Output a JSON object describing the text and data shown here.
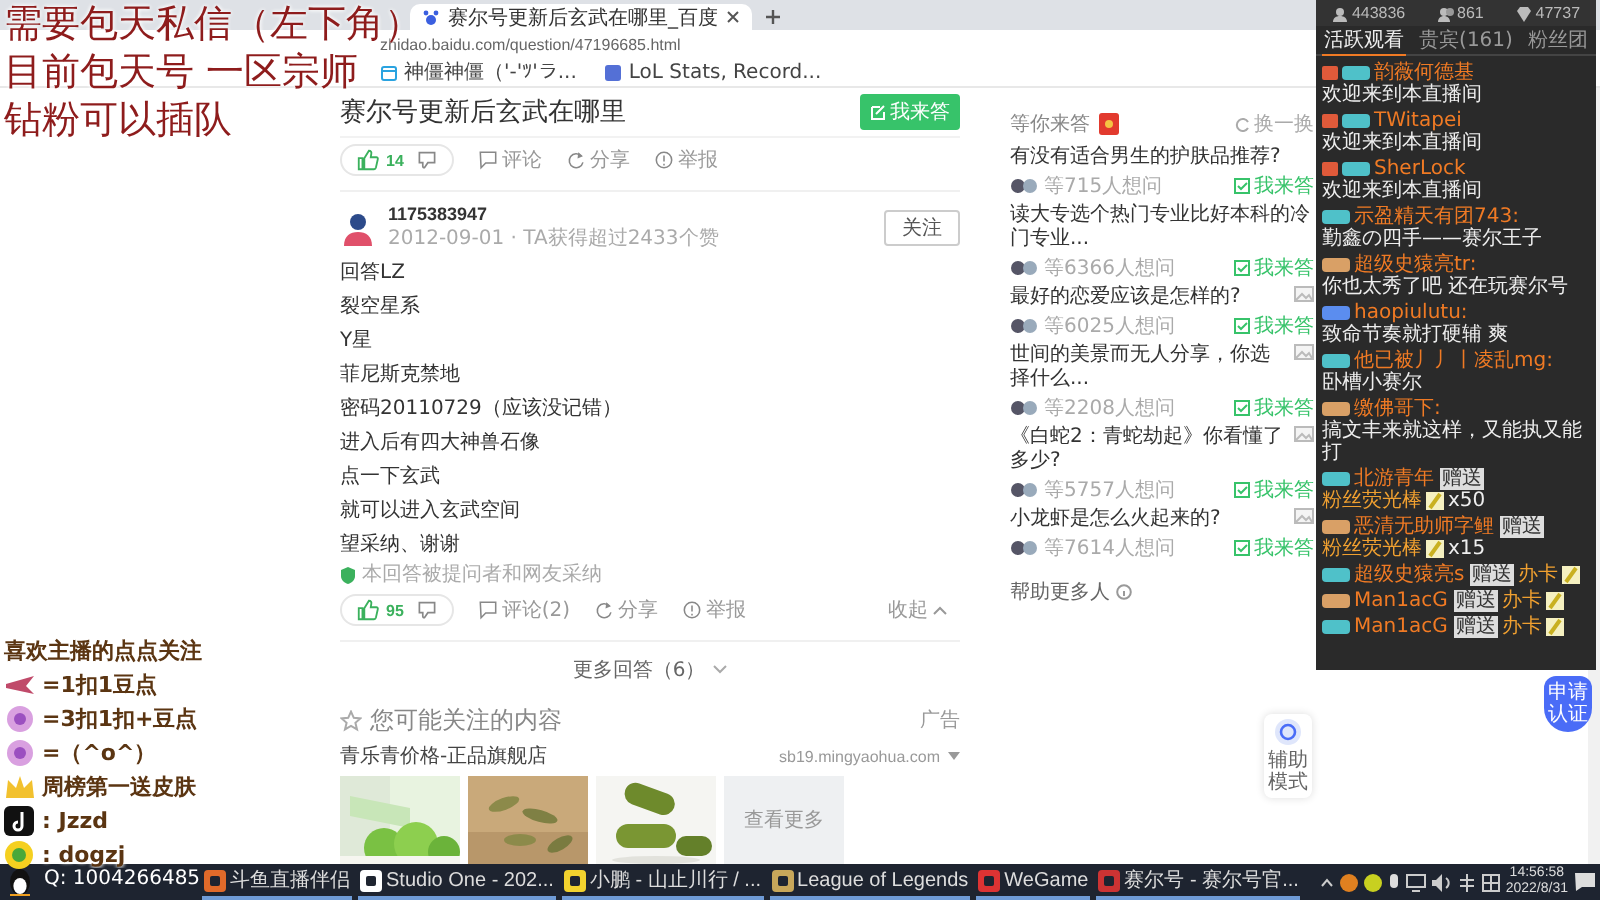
{
  "overlay_notice": [
    "需要包天私信（左下角）",
    "目前包天号 一区宗师",
    "钻粉可以插队"
  ],
  "browser": {
    "tab_title": "赛尔号更新后玄武在哪里_百度",
    "address": "zhidao.baidu.com/question/47196685.html",
    "bookmarks": [
      "神僵神僵（'-'ﾂ'ラ...",
      "LoL Stats, Record..."
    ]
  },
  "question": {
    "title": "赛尔号更新后玄武在哪里",
    "answer_button": "我来答"
  },
  "previous_answer": {
    "votes": "14",
    "actions": [
      "评论",
      "分享",
      "举报"
    ]
  },
  "answer": {
    "user": "1175383947",
    "meta": "2012-09-01 · TA获得超过2433个赞",
    "follow": "关注",
    "lines": [
      "回答LZ",
      "裂空星系",
      "Y星",
      "菲尼斯克禁地",
      "密码20110729（应该没记错）",
      "进入后有四大神兽石像",
      "点一下玄武",
      "就可以进入玄武空间",
      "望采纳、谢谢"
    ],
    "adopted": "本回答被提问者和网友采纳",
    "votes": "95",
    "actions": [
      "评论(2)",
      "分享",
      "举报"
    ],
    "collapse": "收起"
  },
  "more_answers": "更多回答（6）",
  "recommend": {
    "title": "您可能关注的内容",
    "ad_label": "广告",
    "shop": "青乐青价格-正品旗舰店",
    "domain": "sb19.mingyaohua.com",
    "more": "查看更多"
  },
  "sidebar": {
    "title": "等你来答",
    "refresh": "换一换",
    "questions": [
      {
        "text": "有没有适合男生的护肤品推荐?",
        "asked": "等715人想问",
        "button": "我来答",
        "thumbnail": false
      },
      {
        "text": "读大专选个热门专业比好本科的冷门专业...",
        "asked": "等6366人想问",
        "button": "我来答",
        "thumbnail": false
      },
      {
        "text": "最好的恋爱应该是怎样的?",
        "asked": "等6025人想问",
        "button": "我来答",
        "thumbnail": true
      },
      {
        "text": "世间的美景而无人分享，你选择什么...",
        "asked": "等2208人想问",
        "button": "我来答",
        "thumbnail": true
      },
      {
        "text": "《白蛇2：青蛇劫起》你看懂了多少?",
        "asked": "等5757人想问",
        "button": "我来答",
        "thumbnail": true
      },
      {
        "text": "小龙虾是怎么火起来的?",
        "asked": "等7614人想问",
        "button": "我来答",
        "thumbnail": true
      }
    ],
    "help": "帮助更多人"
  },
  "floating": {
    "assist": "辅助模式",
    "certify": "申请认证"
  },
  "chat": {
    "stats": [
      "443836",
      "861",
      "47737"
    ],
    "tabs": [
      {
        "label": "活跃观看",
        "selected": true
      },
      {
        "label": "贵宾(161)",
        "selected": false
      },
      {
        "label": "粉丝团",
        "selected": false
      }
    ],
    "messages": [
      {
        "kind": "welcome",
        "user": "韵薇何德基",
        "text": "欢迎来到本直播间"
      },
      {
        "kind": "welcome",
        "user": "TWitapei",
        "text": "欢迎来到本直播间"
      },
      {
        "kind": "welcome",
        "user": "SherLock",
        "text": "欢迎来到本直播间"
      },
      {
        "kind": "chat",
        "user": "示盈精天有团743:",
        "text": "勤鑫の四手——赛尔王子"
      },
      {
        "kind": "chat",
        "user": "超级史猿亮tr:",
        "text": "你也太秀了吧 还在玩赛尔号"
      },
      {
        "kind": "chat",
        "user": "haopiulutu:",
        "text": "致命节奏就打硬辅 爽"
      },
      {
        "kind": "chat",
        "user": "他已被丿丿丨凌乱mg:",
        "text": "卧槽小赛尔"
      },
      {
        "kind": "chat",
        "user": "缴佛哥下:",
        "text": "搞文丰来就这样，又能执又能打"
      },
      {
        "kind": "gift",
        "user": "北游青年",
        "action": "赠送",
        "gift": "粉丝荧光棒",
        "count": "x50"
      },
      {
        "kind": "gift",
        "user": "恶清无助师字鲤",
        "action": "赠送",
        "gift": "粉丝荧光棒",
        "count": "x15"
      },
      {
        "kind": "gift",
        "user": "超级史猿亮s",
        "action": "赠送",
        "gift": "办卡"
      },
      {
        "kind": "gift",
        "user": "Man1acG",
        "action": "赠送",
        "gift": "办卡"
      },
      {
        "kind": "gift",
        "user": "Man1acG",
        "action": "赠送",
        "gift": "办卡"
      }
    ]
  },
  "streamer_panel": {
    "title": "喜欢主播的点点关注",
    "rules": [
      "=1扣1豆点",
      "=3扣1扣+豆点",
      "=（^o^）",
      "周榜第一送皮肤",
      ": Jzzd",
      ": dogzj"
    ]
  },
  "qq": "Q: 1004266485",
  "taskbar": {
    "items": [
      "斗鱼直播伴侣",
      "Studio One - 202...",
      "小鹏 - 山止川行 / ...",
      "League of Legends",
      "WeGame",
      "赛尔号 - 赛尔号官..."
    ],
    "time": "14:56:58",
    "date": "2022/8/31"
  }
}
